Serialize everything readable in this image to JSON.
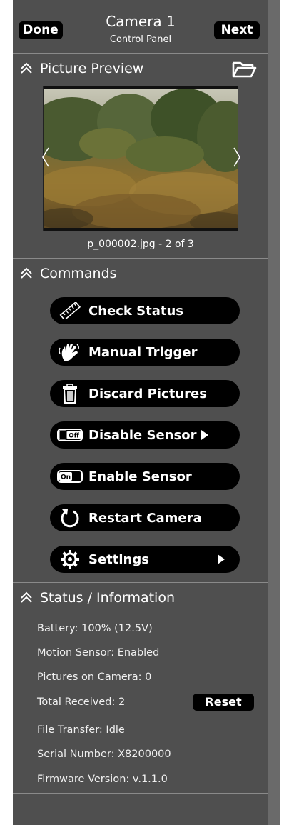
{
  "header": {
    "done_label": "Done",
    "next_label": "Next",
    "title": "Camera 1",
    "subtitle": "Control Panel"
  },
  "preview": {
    "section_title": "Picture Preview",
    "caption": "p_000002.jpg - 2 of 3"
  },
  "commands": {
    "section_title": "Commands",
    "items": [
      {
        "label": "Check Status",
        "icon": "ruler-icon"
      },
      {
        "label": "Manual Trigger",
        "icon": "hand-wave-icon"
      },
      {
        "label": "Discard Pictures",
        "icon": "trash-icon"
      },
      {
        "label": "Disable Sensor",
        "icon": "toggle-off-icon",
        "submenu": true
      },
      {
        "label": "Enable Sensor",
        "icon": "toggle-on-icon"
      },
      {
        "label": "Restart Camera",
        "icon": "restart-icon"
      },
      {
        "label": "Settings",
        "icon": "gear-icon",
        "submenu": true
      }
    ],
    "toggle_off_text": "Off",
    "toggle_on_text": "On"
  },
  "status": {
    "section_title": "Status / Information",
    "battery": "Battery: 100% (12.5V)",
    "motion_sensor": "Motion Sensor:  Enabled",
    "pictures_on_camera": "Pictures on Camera:  0",
    "total_received": "Total Received:  2",
    "reset_label": "Reset",
    "file_transfer": "File Transfer:  Idle",
    "serial_number": "Serial Number: X8200000",
    "firmware_version": "Firmware Version: v.1.1.0"
  },
  "colors": {
    "panel_bg": "#4f4f4f",
    "button_bg": "#000000",
    "text": "#ffffff"
  }
}
